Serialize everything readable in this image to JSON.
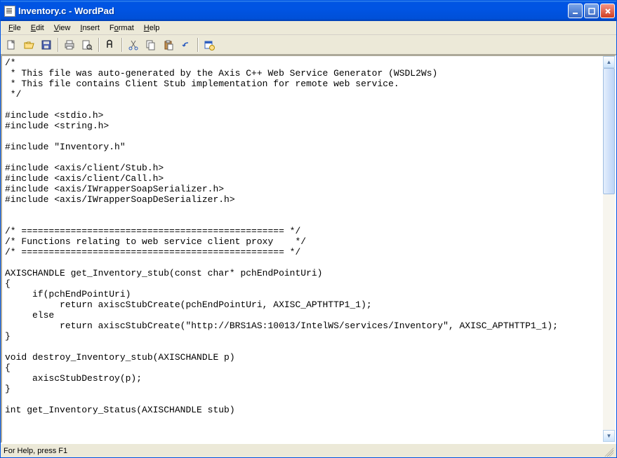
{
  "titlebar": {
    "title": "Inventory.c - WordPad"
  },
  "menu": {
    "file": "File",
    "edit": "Edit",
    "view": "View",
    "insert": "Insert",
    "format": "Format",
    "help": "Help"
  },
  "toolbar_icons": {
    "new": "new-file-icon",
    "open": "open-folder-icon",
    "save": "save-disk-icon",
    "print": "print-icon",
    "preview": "print-preview-icon",
    "find": "find-icon",
    "cut": "cut-icon",
    "copy": "copy-icon",
    "paste": "paste-icon",
    "undo": "undo-icon",
    "datetime": "insert-datetime-icon"
  },
  "document_lines": [
    "/*",
    " * This file was auto-generated by the Axis C++ Web Service Generator (WSDL2Ws)",
    " * This file contains Client Stub implementation for remote web service.",
    " */",
    "",
    "#include <stdio.h>",
    "#include <string.h>",
    "",
    "#include \"Inventory.h\"",
    "",
    "#include <axis/client/Stub.h>",
    "#include <axis/client/Call.h>",
    "#include <axis/IWrapperSoapSerializer.h>",
    "#include <axis/IWrapperSoapDeSerializer.h>",
    "",
    "",
    "/* ================================================ */",
    "/* Functions relating to web service client proxy    */",
    "/* ================================================ */",
    "",
    "AXISCHANDLE get_Inventory_stub(const char* pchEndPointUri)",
    "{",
    "     if(pchEndPointUri)",
    "          return axiscStubCreate(pchEndPointUri, AXISC_APTHTTP1_1);",
    "     else",
    "          return axiscStubCreate(\"http://BRS1AS:10013/IntelWS/services/Inventory\", AXISC_APTHTTP1_1);",
    "}",
    "",
    "void destroy_Inventory_stub(AXISCHANDLE p)",
    "{",
    "     axiscStubDestroy(p);",
    "}",
    "",
    "int get_Inventory_Status(AXISCHANDLE stub)"
  ],
  "statusbar": {
    "text": "For Help, press F1"
  }
}
